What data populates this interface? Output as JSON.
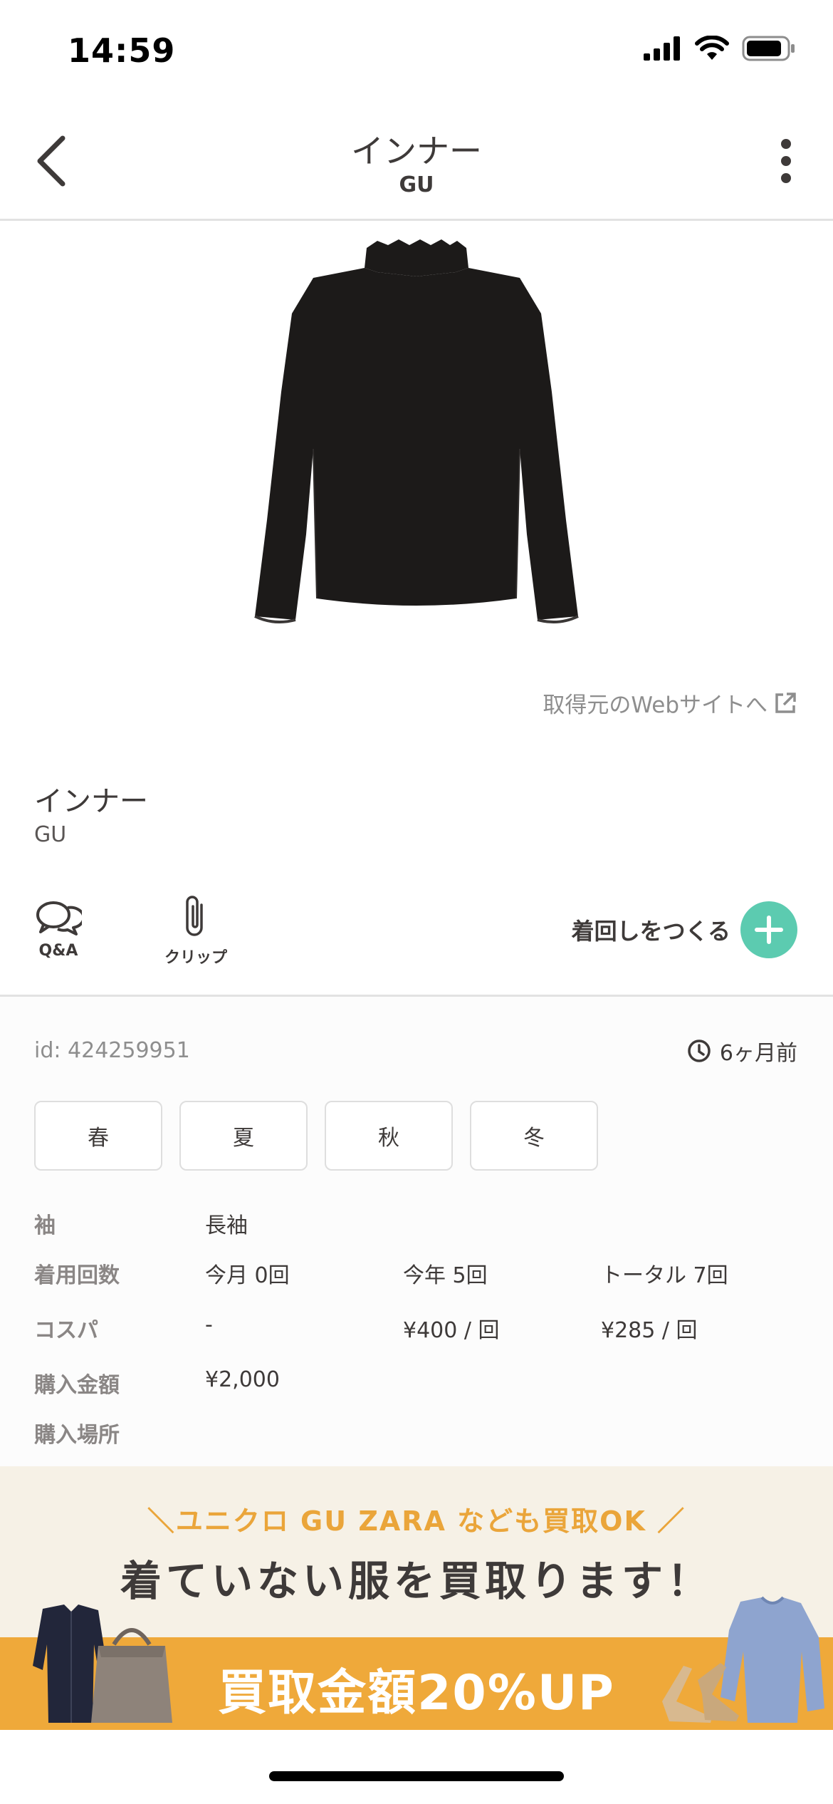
{
  "status_bar": {
    "time": "14:59"
  },
  "nav": {
    "title": "インナー",
    "subtitle": "GU"
  },
  "web_link": {
    "label": "取得元のWebサイトへ"
  },
  "item": {
    "name": "インナー",
    "brand": "GU"
  },
  "actions": {
    "qa_label": "Q&A",
    "clip_label": "クリップ",
    "create_label": "着回しをつくる"
  },
  "details": {
    "id_text": "id: 424259951",
    "time_ago": "6ヶ月前",
    "seasons": [
      "春",
      "夏",
      "秋",
      "冬"
    ],
    "sleeve": {
      "label": "袖",
      "value": "長袖"
    },
    "wear_count": {
      "label": "着用回数",
      "month": "今月 0回",
      "year": "今年 5回",
      "total": "トータル 7回"
    },
    "cost_per_wear": {
      "label": "コスパ",
      "month": "-",
      "year": "¥400 / 回",
      "total": "¥285 / 回"
    },
    "price": {
      "label": "購入金額",
      "value": "¥2,000"
    },
    "store": {
      "label": "購入場所"
    }
  },
  "banner": {
    "lead": "＼ユニクロ GU ZARA なども買取OK ／",
    "headline": "着ていない服を買取ります！",
    "cta": "買取金額20%UP"
  },
  "colors": {
    "accent": "#5ccbb0",
    "banner_orange": "#efa93a",
    "banner_bg": "#f6f1e6",
    "text": "#3e3a39"
  }
}
